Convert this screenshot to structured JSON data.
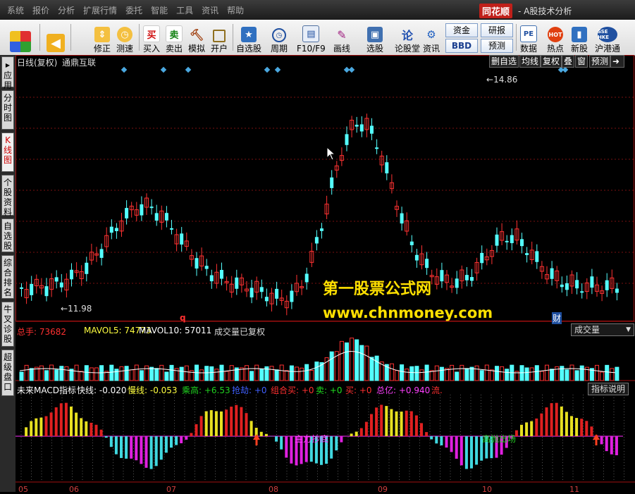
{
  "menubar": {
    "items": [
      "系统",
      "报价",
      "分析",
      "扩展行情",
      "委托",
      "智能",
      "工具",
      "资讯",
      "帮助"
    ],
    "brand": "同花顺",
    "subtitle": "- A股技术分析"
  },
  "toolbar": {
    "buttons": [
      {
        "label": "修正",
        "icon": "up-down-arrows-icon"
      },
      {
        "label": "测速",
        "icon": "clock-icon"
      },
      {
        "label": "买入",
        "icon": "buy-icon",
        "glyph": "买"
      },
      {
        "label": "卖出",
        "icon": "sell-icon",
        "glyph": "卖"
      },
      {
        "label": "模拟",
        "icon": "hammer-icon"
      },
      {
        "label": "开户",
        "icon": "lock-icon"
      },
      {
        "label": "自选股",
        "icon": "star-folder-icon"
      },
      {
        "label": "周期",
        "icon": "clock-cycle-icon"
      },
      {
        "label": "F10/F9",
        "icon": "document-icon"
      },
      {
        "label": "画线",
        "icon": "pen-icon"
      },
      {
        "label": "选股",
        "icon": "screen-icon"
      },
      {
        "label": "论股堂",
        "icon": "forum-icon",
        "glyph": "论"
      },
      {
        "label": "资讯",
        "icon": "news-icon"
      },
      {
        "label": "数据",
        "icon": "pe-icon",
        "glyph": "PE"
      },
      {
        "label": "热点",
        "icon": "hot-icon",
        "glyph": "HOT"
      },
      {
        "label": "新股",
        "icon": "ipo-icon"
      },
      {
        "label": "沪港通",
        "icon": "sse-hkex-icon",
        "glyph": "SSE HKE"
      }
    ],
    "small_buttons": [
      "资金",
      "BBD",
      "研报",
      "预测"
    ]
  },
  "sidebar": {
    "tabs": [
      "应用",
      "分时图",
      "K线图",
      "个股资料",
      "自选股",
      "综合排名",
      "牛叉诊股",
      "超级盘口"
    ]
  },
  "kpanel": {
    "title": "日线(复权)",
    "stock_name": "通鼎互联",
    "buttons": [
      "删自选",
      "均线",
      "复权",
      "叠",
      "窗",
      "预测"
    ],
    "max_label": "14.86",
    "min_label": "11.98",
    "marker_q": "q",
    "marker_cai": "财"
  },
  "watermark": {
    "line1": "第一股票公式网",
    "line2": "www.chnmoney.com"
  },
  "volpanel": {
    "label_total": "总手: 73682",
    "label_ma5": "MAVOL5: 74773",
    "label_ma10": "MAVOL10: 57011",
    "label_fq": "成交量已复权",
    "selector": "成交量"
  },
  "macdpanel": {
    "name": "未来MACD指标",
    "fast": "快线: -0.020",
    "slow": "慢线: -0.053",
    "chenggao": "乘高: +6.53",
    "qiangjie": "抢劫: +0",
    "zuhemai": "组合买: +0",
    "mai_out": "卖: +0",
    "mai_in": "买: +0",
    "zongyi": "总亿: +0.940",
    "liu": "流.",
    "help": "指标说明",
    "annot1": "主力抄底",
    "annot2": "高抛出场"
  },
  "xaxis": {
    "labels": [
      "05",
      "06",
      "07",
      "08",
      "09",
      "10",
      "11"
    ]
  },
  "colors": {
    "up": "#ff3232",
    "down": "#54ffff",
    "macd_red": "#e02020",
    "macd_yellow": "#e8e020",
    "macd_cyan": "#40d8e0",
    "macd_magenta": "#e020e0"
  }
}
